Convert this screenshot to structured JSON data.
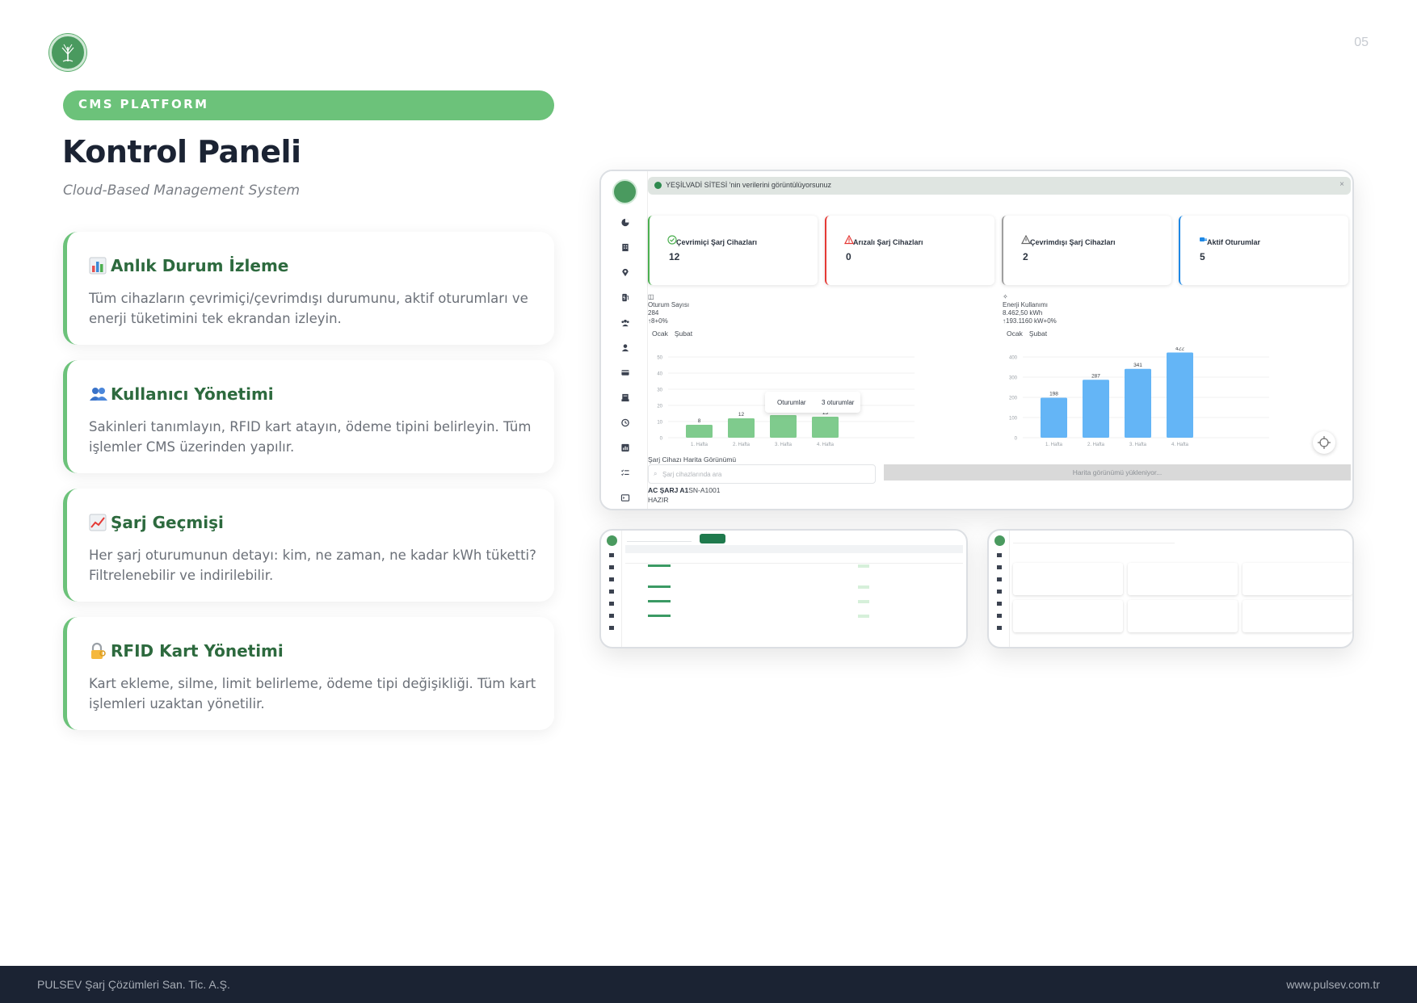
{
  "page_number": "05",
  "badge": "CMS PLATFORM",
  "title": "Kontrol Paneli",
  "subtitle": "Cloud-Based Management System",
  "features": [
    {
      "icon": "bar-chart-icon",
      "title": "Anlık Durum İzleme",
      "desc": "Tüm cihazların çevrimiçi/çevrimdışı durumunu, aktif oturumları ve enerji tüketimini tek ekrandan izleyin."
    },
    {
      "icon": "users-icon",
      "title": "Kullanıcı Yönetimi",
      "desc": "Sakinleri tanımlayın, RFID kart atayın, ödeme tipini belirleyin. Tüm işlemler CMS üzerinden yapılır."
    },
    {
      "icon": "trend-up-icon",
      "title": "Şarj Geçmişi",
      "desc": "Her şarj oturumunun detayı: kim, ne zaman, ne kadar kWh tüketti? Filtrelenebilir ve indirilebilir."
    },
    {
      "icon": "lock-key-icon",
      "title": "RFID Kart Yönetimi",
      "desc": "Kart ekleme, silme, limit belirleme, ödeme tipi değişikliği. Tüm kart işlemleri uzaktan yönetilir."
    }
  ],
  "dashboard": {
    "banner": "YEŞİLVADİ SİTESİ 'nin verilerini görüntülüyorsunuz",
    "banner_close": "×",
    "cards": [
      {
        "label": "Çevrimiçi Şarj Cihazları",
        "value": "12",
        "color": "#4caf50",
        "icon": "check-circle-icon"
      },
      {
        "label": "Arızalı Şarj Cihazları",
        "value": "0",
        "color": "#e53935",
        "icon": "warning-icon"
      },
      {
        "label": "Çevrimdışı Şarj Cihazları",
        "value": "2",
        "color": "#9e9e9e",
        "icon": "alert-triangle-icon"
      },
      {
        "label": "Aktif Oturumlar",
        "value": "5",
        "color": "#1e88e5",
        "icon": "plug-icon"
      }
    ],
    "sessions": {
      "label": "Oturum Sayısı",
      "value": "284",
      "change": "8+0%",
      "tabs": [
        "Ocak",
        "Şubat"
      ]
    },
    "energy": {
      "label": "Enerji Kullanımı",
      "value": "8.462,50 kWh",
      "change": "193.1160 kW+0%",
      "tabs": [
        "Ocak",
        "Şubat"
      ]
    },
    "tooltip": {
      "label": "Oturumlar",
      "value": "3 oturumlar"
    },
    "map_title": "Şarj Cihazı Harita Görünümü",
    "map_search_placeholder": "Şarj cihazlarında ara",
    "map_loading": "Harita görünümü yükleniyor...",
    "station_name": "AC ŞARJ A1",
    "station_serial": "SN-A1001",
    "station_status": "HAZIR"
  },
  "chart_data": [
    {
      "type": "bar",
      "categories": [
        "1. Hafta",
        "2. Hafta",
        "3. Hafta",
        "4. Hafta"
      ],
      "values": [
        8,
        12,
        14,
        13
      ],
      "ylim": [
        0,
        50
      ],
      "yticks": [
        0,
        10,
        20,
        30,
        40,
        50
      ],
      "color": "#7fcb8d"
    },
    {
      "type": "bar",
      "categories": [
        "1. Hafta",
        "2. Hafta",
        "3. Hafta",
        "4. Hafta"
      ],
      "values": [
        198,
        287,
        341,
        422
      ],
      "ylim": [
        0,
        400
      ],
      "yticks": [
        0,
        100,
        200,
        300,
        400
      ],
      "color": "#64b5f6"
    }
  ],
  "footer": {
    "left": "PULSEV Şarj Çözümleri San. Tic. A.Ş.",
    "right": "www.pulsev.com.tr"
  }
}
